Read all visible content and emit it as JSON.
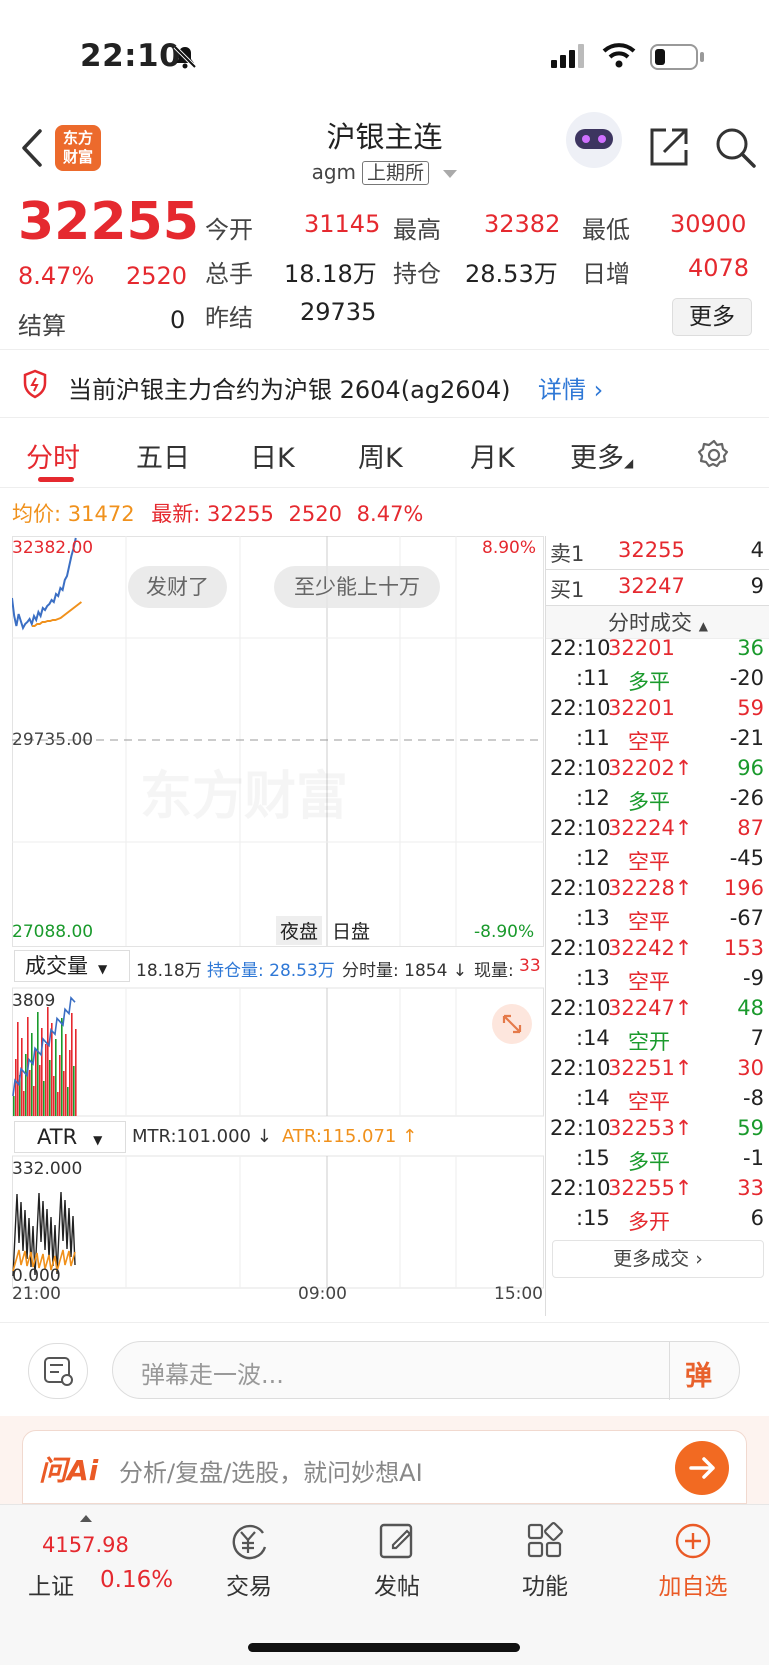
{
  "status_bar": {
    "time": "22:10"
  },
  "header": {
    "title": "沪银主连",
    "code": "agm",
    "exchange_tag": "上期所",
    "logo_line1": "东方",
    "logo_line2": "财富"
  },
  "quote": {
    "price": "32255",
    "change_pct": "8.47%",
    "change": "2520",
    "settle_label": "结算",
    "settle_value": "0",
    "open_label": "今开",
    "open_value": "31145",
    "high_label": "最高",
    "high_value": "32382",
    "low_label": "最低",
    "low_value": "30900",
    "volume_label": "总手",
    "volume_value": "18.18万",
    "oi_label": "持仓",
    "oi_value": "28.53万",
    "daily_inc_label": "日增",
    "daily_inc_value": "4078",
    "prev_settle_label": "昨结",
    "prev_settle_value": "29735",
    "more_button": "更多"
  },
  "notice": {
    "text": "当前沪银主力合约为沪银 2604(ag2604)",
    "link": "详情"
  },
  "tabs": {
    "t1": "分时",
    "t2": "五日",
    "t3": "日K",
    "t4": "周K",
    "t5": "月K",
    "t6": "更多"
  },
  "avg_line": {
    "avg_label": "均价:",
    "avg_value": "31472",
    "latest_label": "最新:",
    "latest_value": "32255",
    "change": "2520",
    "change_pct": "8.47%"
  },
  "chart": {
    "y_top": "32382.00",
    "y_mid": "29735.00",
    "y_bottom": "27088.00",
    "pct_top": "8.90%",
    "pct_bottom": "-8.90%",
    "bubble1": "发财了",
    "bubble2": "至少能上十万",
    "watermark": "东方财富",
    "night_session": "夜盘",
    "day_session": "日盘",
    "vol_selector": "成交量",
    "vol_total": "18.18万",
    "oi_label": "持仓量: 28.53万",
    "interval_vol": "分时量: 1854 ↓",
    "current_vol_label": "现量:",
    "current_vol": "33",
    "vol_max": "3809",
    "atr_selector": "ATR",
    "mtr": "MTR:101.000 ↓",
    "atr": "ATR:115.071 ↑",
    "atr_max": "332.000",
    "atr_min": "0.000",
    "x_start": "21:00",
    "x_mid": "09:00",
    "x_end": "15:00"
  },
  "order_book": {
    "ask_label": "卖1",
    "ask_price": "32255",
    "ask_qty": "4",
    "bid_label": "买1",
    "bid_price": "32247",
    "bid_qty": "9"
  },
  "trades": {
    "header": "分时成交",
    "rows": [
      {
        "t": "22:10",
        "p": "32201",
        "v": "36",
        "vc": "green",
        "pc": "red"
      },
      {
        "t": ":11",
        "p": "多平",
        "v": "-20",
        "vc": "dark",
        "pc": "green"
      },
      {
        "t": "22:10",
        "p": "32201",
        "v": "59",
        "vc": "red",
        "pc": "red"
      },
      {
        "t": ":11",
        "p": "空平",
        "v": "-21",
        "vc": "dark",
        "pc": "red"
      },
      {
        "t": "22:10",
        "p": "32202↑",
        "v": "96",
        "vc": "green",
        "pc": "red"
      },
      {
        "t": ":12",
        "p": "多平",
        "v": "-26",
        "vc": "dark",
        "pc": "green"
      },
      {
        "t": "22:10",
        "p": "32224↑",
        "v": "87",
        "vc": "red",
        "pc": "red"
      },
      {
        "t": ":12",
        "p": "空平",
        "v": "-45",
        "vc": "dark",
        "pc": "red"
      },
      {
        "t": "22:10",
        "p": "32228↑",
        "v": "196",
        "vc": "red",
        "pc": "red"
      },
      {
        "t": ":13",
        "p": "空平",
        "v": "-67",
        "vc": "dark",
        "pc": "red"
      },
      {
        "t": "22:10",
        "p": "32242↑",
        "v": "153",
        "vc": "red",
        "pc": "red"
      },
      {
        "t": ":13",
        "p": "空平",
        "v": "-9",
        "vc": "dark",
        "pc": "red"
      },
      {
        "t": "22:10",
        "p": "32247↑",
        "v": "48",
        "vc": "green",
        "pc": "red"
      },
      {
        "t": ":14",
        "p": "空开",
        "v": "7",
        "vc": "dark",
        "pc": "green"
      },
      {
        "t": "22:10",
        "p": "32251↑",
        "v": "30",
        "vc": "red",
        "pc": "red"
      },
      {
        "t": ":14",
        "p": "空平",
        "v": "-8",
        "vc": "dark",
        "pc": "red"
      },
      {
        "t": "22:10",
        "p": "32253↑",
        "v": "59",
        "vc": "green",
        "pc": "red"
      },
      {
        "t": ":15",
        "p": "多平",
        "v": "-1",
        "vc": "dark",
        "pc": "green"
      },
      {
        "t": "22:10",
        "p": "32255↑",
        "v": "33",
        "vc": "red",
        "pc": "red"
      },
      {
        "t": ":15",
        "p": "多开",
        "v": "6",
        "vc": "dark",
        "pc": "red"
      }
    ],
    "more_button": "更多成交"
  },
  "comment": {
    "placeholder": "弹幕走一波...",
    "danmaku_button": "弹"
  },
  "ai_bar": {
    "logo": "问Ai",
    "placeholder": "分析/复盘/选股，就问妙想AI"
  },
  "bottom_nav": {
    "index_value": "4157.98",
    "index_name": "上证",
    "index_change": "0.16%",
    "trade": "交易",
    "post": "发帖",
    "functions": "功能",
    "add_watch": "加自选"
  }
}
